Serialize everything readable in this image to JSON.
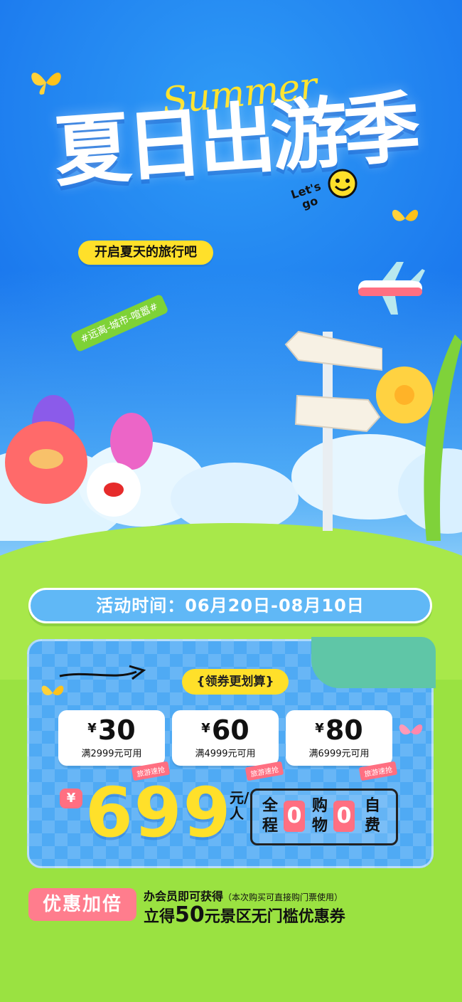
{
  "hero": {
    "title": "夏日出游季",
    "script_word": "Summer",
    "badge_text": "Let's go",
    "subtitle": "开启夏天的旅行吧",
    "tag": "#远离-城市-喧嚣#"
  },
  "event": {
    "time_label": "活动时间：",
    "time_range": "06月20日-08月10日"
  },
  "coupons": {
    "header": "{领券更划算}",
    "items": [
      {
        "amount": "30",
        "condition": "满2999元可用",
        "badge": "旅游速抢"
      },
      {
        "amount": "60",
        "condition": "满4999元可用",
        "badge": "旅游速抢"
      },
      {
        "amount": "80",
        "condition": "满6999元可用",
        "badge": "旅游速抢"
      }
    ],
    "currency_symbol": "¥"
  },
  "price": {
    "currency_symbol": "¥",
    "value": "699",
    "unit": "元/人"
  },
  "features": {
    "col1": "全程",
    "zero1": "0",
    "col2": "购物",
    "zero2": "0",
    "col3": "自费"
  },
  "promo": {
    "label": "优惠加倍",
    "line1": "办会员即可获得",
    "line1_note": "（本次购买可直接购门票使用）",
    "line2_prefix": "立得",
    "line2_amount": "50",
    "line2_suffix": "元景区无门槛优惠券"
  },
  "colors": {
    "sky": "#1f7df0",
    "grass": "#9ae241",
    "yellow": "#ffe02a",
    "pink": "#ff6f81",
    "card_blue": "#4faaf4",
    "card_teal": "#5fc6a7"
  }
}
